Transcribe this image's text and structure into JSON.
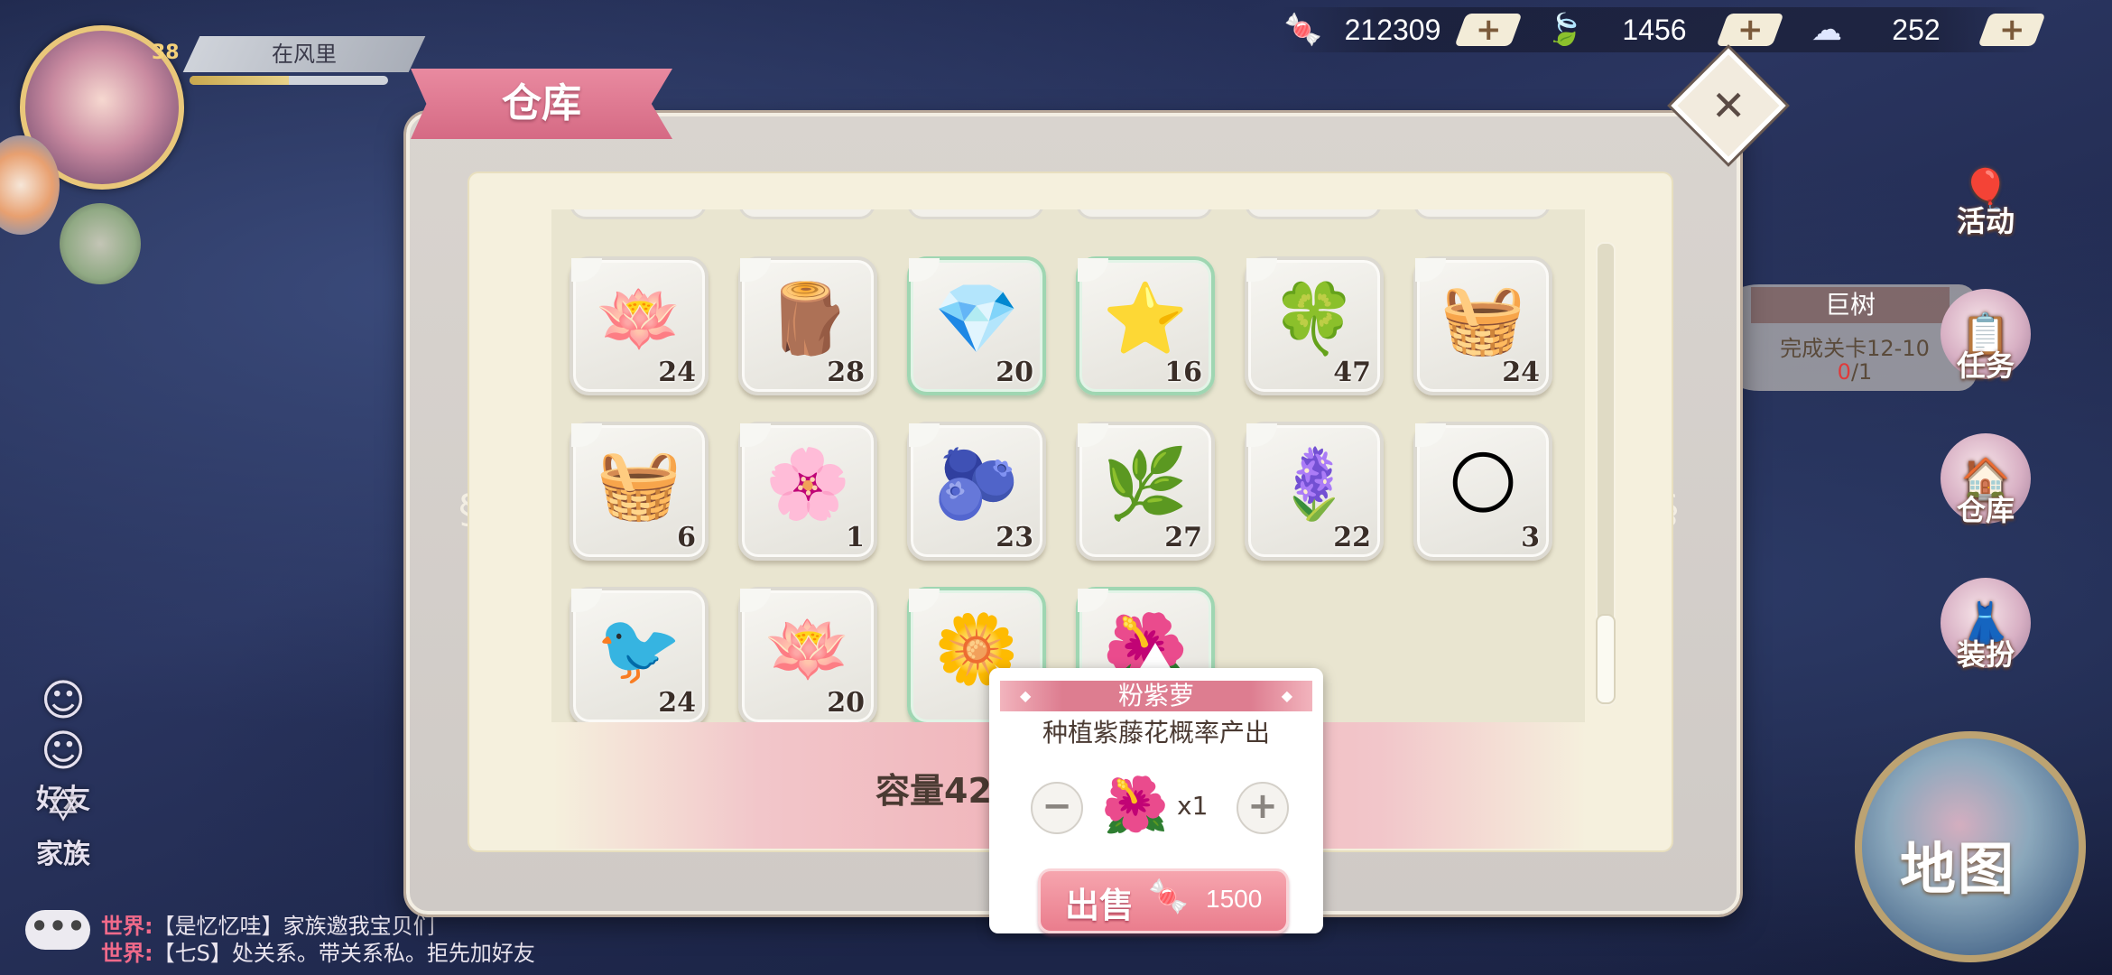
{
  "currency": [
    {
      "icon": "candy-gem-icon",
      "glyph": "🍬",
      "value": "212309"
    },
    {
      "icon": "leaf-icon",
      "glyph": "🍃",
      "value": "1456"
    },
    {
      "icon": "cloud-sheep-icon",
      "glyph": "☁",
      "value": "252"
    }
  ],
  "player": {
    "level": "38",
    "name": "在风里",
    "xp_fraction": 0.5
  },
  "left_menu": {
    "friends": "好友",
    "family": "家族"
  },
  "chat": [
    {
      "tag": "世界:",
      "text": "【是忆忆哇】家族邀我宝贝们"
    },
    {
      "tag": "世界:",
      "text": "【七S】处关系。带关系私。拒先加好友"
    }
  ],
  "right_menu": {
    "activity": "活动",
    "quest": "任务",
    "warehouse": "仓库",
    "dressup": "装扮",
    "map": "地图"
  },
  "quest": {
    "title": "巨树",
    "desc": "完成关卡12-10",
    "progress_current": "0",
    "progress_total": "/1"
  },
  "warehouse": {
    "title": "仓库",
    "capacity_label": "容量42",
    "items": [
      {
        "name": "crystal-lotus",
        "glyph": "🪷",
        "count": "24",
        "rare": false
      },
      {
        "name": "wood-peg",
        "glyph": "🪵",
        "count": "28",
        "rare": false
      },
      {
        "name": "jade-leaf",
        "glyph": "💎",
        "count": "20",
        "rare": true
      },
      {
        "name": "crystal-star",
        "glyph": "⭐",
        "count": "16",
        "rare": true
      },
      {
        "name": "lotus-leaf",
        "glyph": "🍀",
        "count": "47",
        "rare": false
      },
      {
        "name": "petal-basket",
        "glyph": "🧺",
        "count": "24",
        "rare": false
      },
      {
        "name": "gem-basket",
        "glyph": "🧺",
        "count": "6",
        "rare": false
      },
      {
        "name": "cherry-blossom",
        "glyph": "🌸",
        "count": "1",
        "rare": false
      },
      {
        "name": "beetroot",
        "glyph": "🫐",
        "count": "23",
        "rare": false
      },
      {
        "name": "lavender-sprig",
        "glyph": "🌿",
        "count": "27",
        "rare": false
      },
      {
        "name": "purple-wisteria",
        "glyph": "🪻",
        "count": "22",
        "rare": false
      },
      {
        "name": "moon-cake",
        "glyph": "🌕",
        "count": "3",
        "rare": false
      },
      {
        "name": "bird-nest",
        "glyph": "🐦",
        "count": "24",
        "rare": false
      },
      {
        "name": "green-lotus",
        "glyph": "🪷",
        "count": "20",
        "rare": false
      },
      {
        "name": "yellow-flower",
        "glyph": "🌼",
        "count": "",
        "rare": true
      },
      {
        "name": "pink-wisteria",
        "glyph": "🌺",
        "count": "",
        "rare": true
      }
    ],
    "scroll_position": 0.85
  },
  "popup": {
    "item_name": "粉紫萝",
    "description": "种植紫藤花概率产出",
    "quantity": "x1",
    "minus": "−",
    "plus": "+",
    "sell_label": "出售",
    "price": "1500"
  },
  "colors": {
    "accent_pink": "#e27a8e",
    "panel_cream": "#f5f0dd",
    "rare_green": "#9fd6b2"
  }
}
